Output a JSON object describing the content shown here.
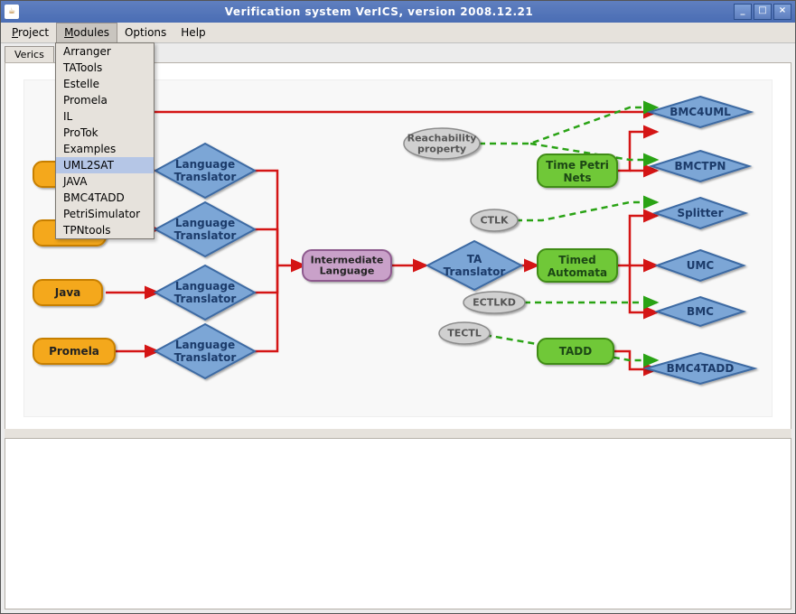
{
  "window": {
    "title": "Verification system VerICS, version 2008.12.21",
    "buttons": {
      "minimize": "_",
      "maximize": "□",
      "close": "×"
    }
  },
  "menubar": {
    "items": [
      "Project",
      "Modules",
      "Options",
      "Help"
    ],
    "active_index": 1
  },
  "dropdown": {
    "items": [
      "Arranger",
      "TATools",
      "Estelle",
      "Promela",
      "IL",
      "ProTok",
      "Examples",
      "UML2SAT",
      "JAVA",
      "BMC4TADD",
      "PetriSimulator",
      "TPNtools"
    ],
    "highlight_index": 7
  },
  "tabs": {
    "items": [
      "Verics"
    ]
  },
  "diagram": {
    "inputs": {
      "java": "Java",
      "promela": "Promela"
    },
    "lt_label_line1": "Language",
    "lt_label_line2": "Translator",
    "intermediate_l1": "Intermediate",
    "intermediate_l2": "Language",
    "ta_l1": "TA",
    "ta_l2": "Translator",
    "properties": {
      "reach_l1": "Reachability",
      "reach_l2": "property",
      "ectlkd": "ECTLKD",
      "tectl": "TECTL",
      "ctlk": "CTLK"
    },
    "nets": {
      "tpn_l1": "Time Petri",
      "tpn_l2": "Nets",
      "ta_auto_l1": "Timed",
      "ta_auto_l2": "Automata",
      "tadd": "TADD"
    },
    "outputs": {
      "bmc4uml": "BMC4UML",
      "bmctpn": "BMCTPN",
      "splitter": "Splitter",
      "umc": "UMC",
      "bmc": "BMC",
      "bmc4tadd": "BMC4TADD"
    }
  }
}
